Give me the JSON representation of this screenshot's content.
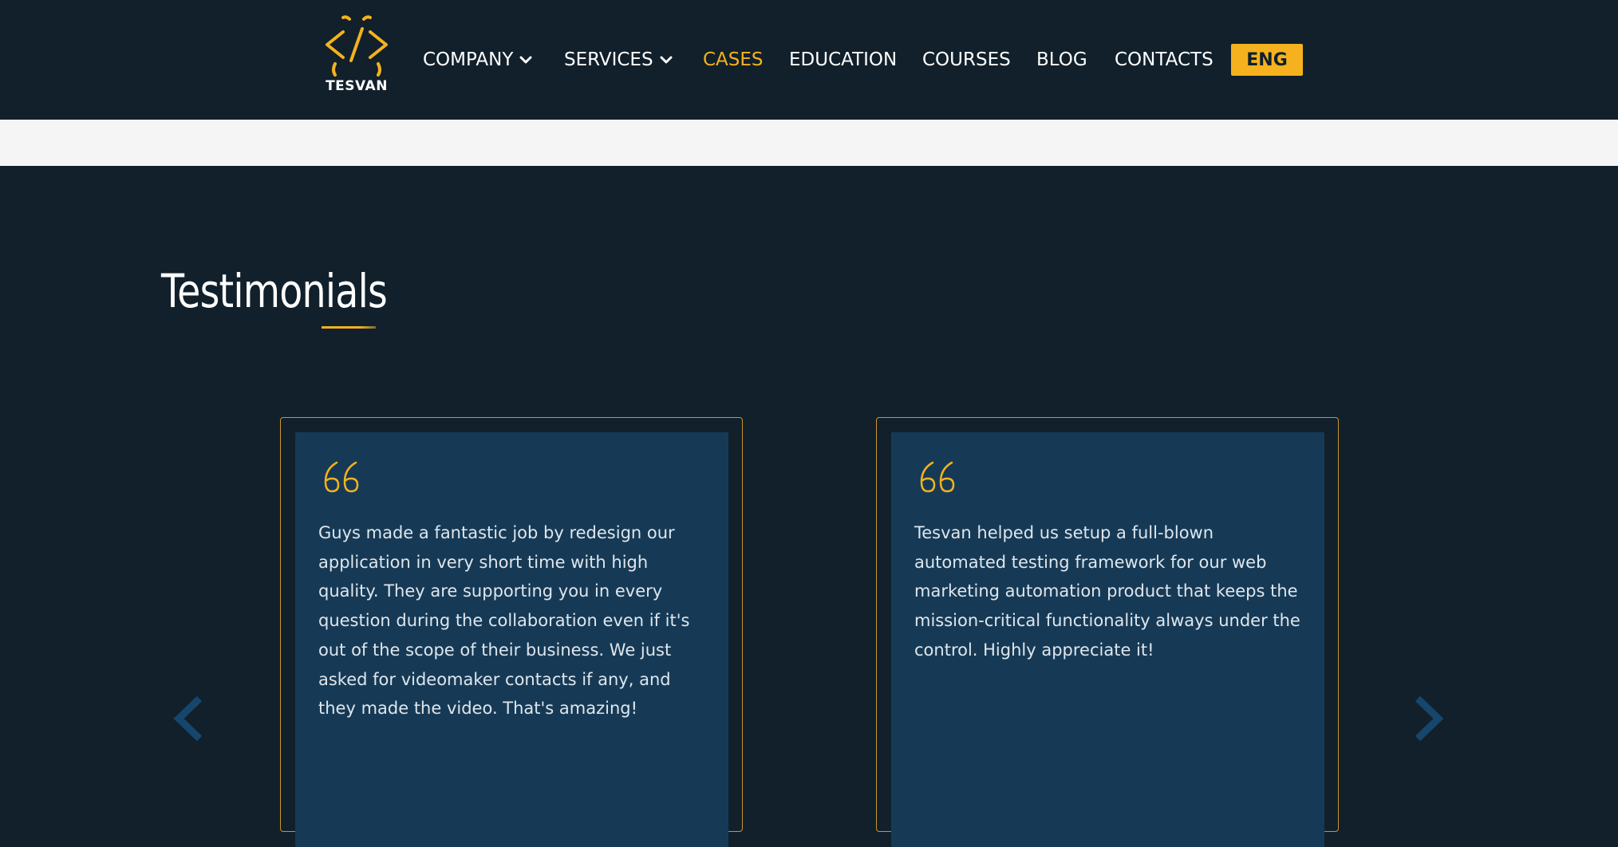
{
  "brand": {
    "name": "TESVAN",
    "accent_color": "#f5b21e",
    "background_color": "#11202b",
    "card_color": "#163a56"
  },
  "nav": {
    "items": [
      {
        "label": "COMPANY",
        "has_dropdown": true,
        "active": false
      },
      {
        "label": "SERVICES",
        "has_dropdown": true,
        "active": false
      },
      {
        "label": "CASES",
        "has_dropdown": false,
        "active": true
      },
      {
        "label": "EDUCATION",
        "has_dropdown": false,
        "active": false
      },
      {
        "label": "COURSES",
        "has_dropdown": false,
        "active": false
      },
      {
        "label": "BLOG",
        "has_dropdown": false,
        "active": false
      },
      {
        "label": "CONTACTS",
        "has_dropdown": false,
        "active": false
      }
    ],
    "language": "ENG"
  },
  "testimonials": {
    "title": "Testimonials",
    "cards": [
      {
        "quote_icon": "quote-icon",
        "text": "Guys made a fantastic job by redesign our application in very short time with high quality. They are supporting you in every question during the collaboration even if it's out of the scope of their business. We just asked for videomaker contacts if any, and they made the video. That's amazing!"
      },
      {
        "quote_icon": "quote-icon",
        "text": "Tesvan helped us setup a full-blown automated testing framework for our web marketing automation product that keeps the mission-critical functionality always under the control. Highly appreciate it!"
      }
    ],
    "prev_icon": "chevron-left-icon",
    "next_icon": "chevron-right-icon"
  }
}
